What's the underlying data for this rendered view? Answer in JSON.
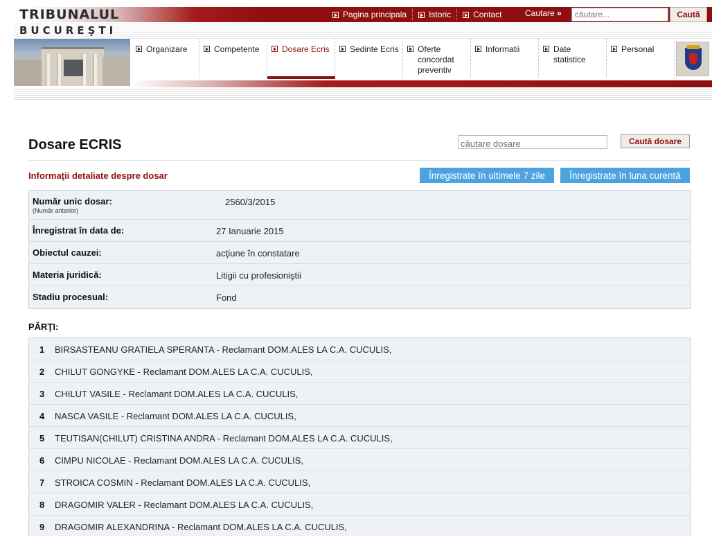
{
  "header": {
    "brand_line1": "TRIBUNALUL",
    "brand_line2": "BUCUREŞTI",
    "top_links": [
      "Pagina principala",
      "Istoric",
      "Contact"
    ],
    "search_label": "Cautare",
    "search_placeholder": "căutare...",
    "search_button": "Caută"
  },
  "nav": {
    "items": [
      {
        "label": "Organizare",
        "active": false
      },
      {
        "label": "Competente",
        "active": false
      },
      {
        "label": "Dosare Ecris",
        "active": true
      },
      {
        "label": "Sedinte Ecris",
        "active": false
      },
      {
        "label": "Oferte concordat preventiv",
        "active": false
      },
      {
        "label": "Informatii",
        "active": false
      },
      {
        "label": "Date statistice",
        "active": false
      },
      {
        "label": "Personal",
        "active": false
      }
    ]
  },
  "main": {
    "title": "Dosare ECRIS",
    "dosar_search_placeholder": "căutare dosare",
    "dosar_search_button": "Caută dosare",
    "subtitle": "Informaţii detaliate despre dosar",
    "btn_last7": "Înregistrate în ultimele 7 zile",
    "btn_month": "Înregistrate în luna curentă",
    "details": [
      {
        "label": "Număr unic dosar:",
        "sublabel": "(Număr anterior)",
        "value": "2560/3/2015"
      },
      {
        "label": "Înregistrat în data de:",
        "value": "27 Ianuarie 2015"
      },
      {
        "label": "Obiectul cauzei:",
        "value": "acţiune în constatare"
      },
      {
        "label": "Materia juridică:",
        "value": "Litigii cu profesioniştii"
      },
      {
        "label": "Stadiu procesual:",
        "value": "Fond"
      }
    ],
    "parti_title": "PĂRŢI:",
    "parti": [
      {
        "num": "1",
        "text": "BIRSASTEANU GRATIELA SPERANTA - Reclamant DOM.ALES LA C.A. CUCULIS,"
      },
      {
        "num": "2",
        "text": "CHILUT GONGYKE - Reclamant DOM.ALES LA C.A. CUCULIS,"
      },
      {
        "num": "3",
        "text": "CHILUT VASILE - Reclamant DOM.ALES LA C.A. CUCULIS,"
      },
      {
        "num": "4",
        "text": "NASCA VASILE - Reclamant DOM.ALES LA C.A. CUCULIS,"
      },
      {
        "num": "5",
        "text": "TEUTISAN(CHILUT) CRISTINA ANDRA - Reclamant DOM.ALES LA C.A. CUCULIS,"
      },
      {
        "num": "6",
        "text": "CIMPU NICOLAE - Reclamant DOM.ALES LA C.A. CUCULIS,"
      },
      {
        "num": "7",
        "text": "STROICA COSMIN - Reclamant DOM.ALES LA C.A. CUCULIS,"
      },
      {
        "num": "8",
        "text": "DRAGOMIR VALER - Reclamant DOM.ALES LA C.A. CUCULIS,"
      },
      {
        "num": "9",
        "text": "DRAGOMIR ALEXANDRINA - Reclamant DOM.ALES LA C.A. CUCULIS,"
      }
    ]
  },
  "colors": {
    "brand_red": "#8e0f0f",
    "button_blue": "#4da3e0",
    "panel_bg": "#eef2f6"
  }
}
